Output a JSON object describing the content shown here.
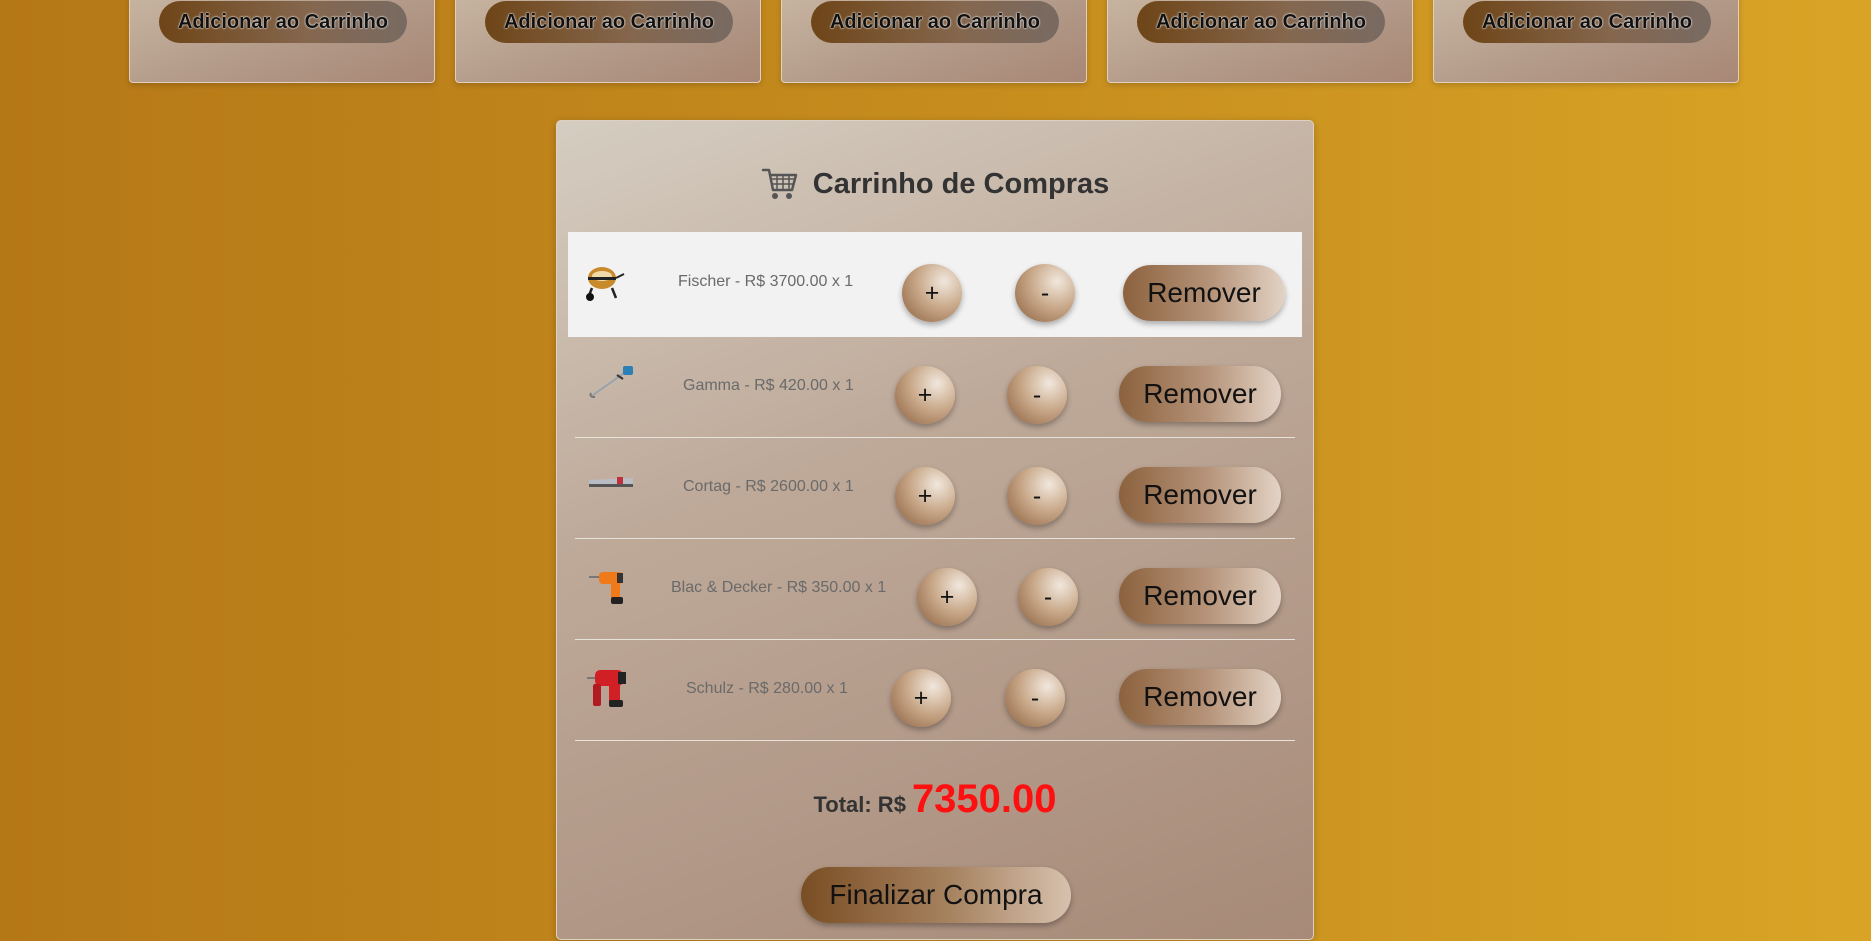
{
  "products": [
    {
      "add_label": "Adicionar ao Carrinho"
    },
    {
      "add_label": "Adicionar ao Carrinho"
    },
    {
      "add_label": "Adicionar ao Carrinho"
    },
    {
      "add_label": "Adicionar ao Carrinho"
    },
    {
      "add_label": "Adicionar ao Carrinho"
    }
  ],
  "cart": {
    "title": "Carrinho de Compras",
    "icon": "shopping-cart-icon",
    "items": [
      {
        "label": "Fischer - R$ 3700.00 x 1",
        "thumb": "concrete-mixer-icon",
        "plus": "+",
        "minus": "-",
        "remove": "Remover"
      },
      {
        "label": "Gamma - R$ 420.00 x 1",
        "thumb": "string-trimmer-icon",
        "plus": "+",
        "minus": "-",
        "remove": "Remover"
      },
      {
        "label": "Cortag - R$ 2600.00 x 1",
        "thumb": "tile-cutter-icon",
        "plus": "+",
        "minus": "-",
        "remove": "Remover"
      },
      {
        "label": "Blac & Decker - R$ 350.00 x 1",
        "thumb": "orange-drill-icon",
        "plus": "+",
        "minus": "-",
        "remove": "Remover"
      },
      {
        "label": "Schulz - R$ 280.00 x 1",
        "thumb": "red-drill-icon",
        "plus": "+",
        "minus": "-",
        "remove": "Remover"
      }
    ],
    "total_label": "Total: R$",
    "total_value": "7350.00",
    "checkout_label": "Finalizar Compra"
  },
  "colors": {
    "total_value": "#ff1010",
    "title": "#333333",
    "item_text": "#6a6a6a",
    "highlight_row": "#f2f2f2"
  }
}
